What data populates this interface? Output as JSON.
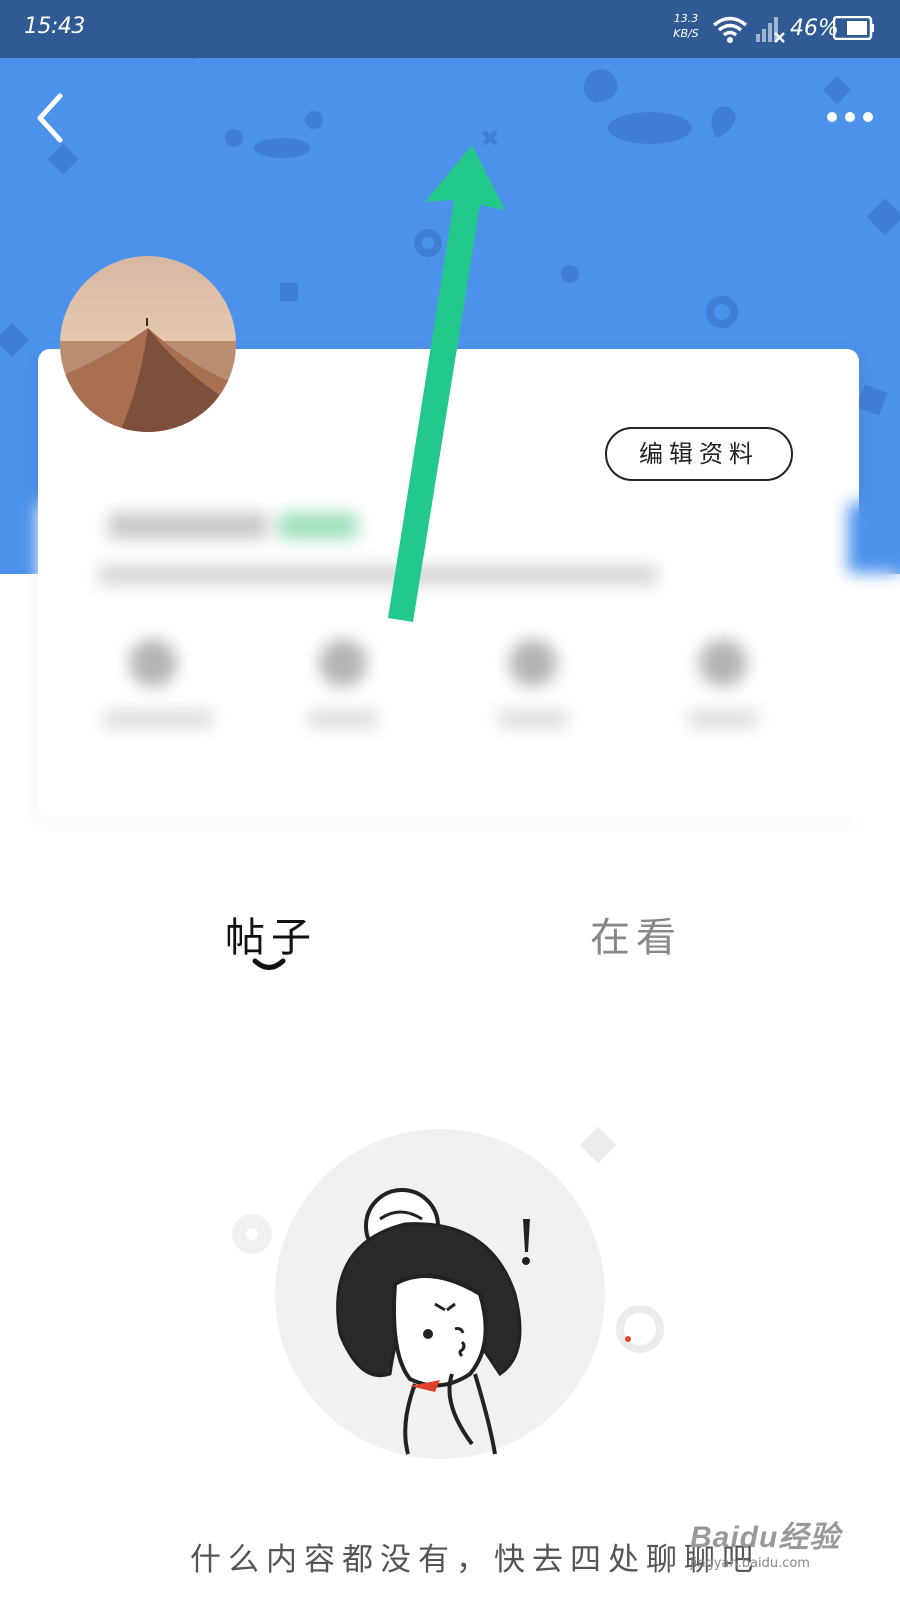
{
  "status_bar": {
    "time": "15:43",
    "net_speed_value": "13.3",
    "net_speed_unit": "KB/S",
    "battery": "46%"
  },
  "header": {
    "background_color": "#4c92eb",
    "back_icon": "chevron-left-icon",
    "more_icon": "more-dots-icon"
  },
  "profile": {
    "edit_button_label": "编辑资料"
  },
  "tabs": [
    {
      "label": "帖子",
      "active": true
    },
    {
      "label": "在看",
      "active": false
    }
  ],
  "empty_state": {
    "message": "什么内容都没有，快去四处聊聊吧"
  },
  "watermark": {
    "brand": "Baidu经验",
    "url": "jingyan.baidu.com"
  },
  "annotation": {
    "arrow_color": "#22c98a"
  }
}
